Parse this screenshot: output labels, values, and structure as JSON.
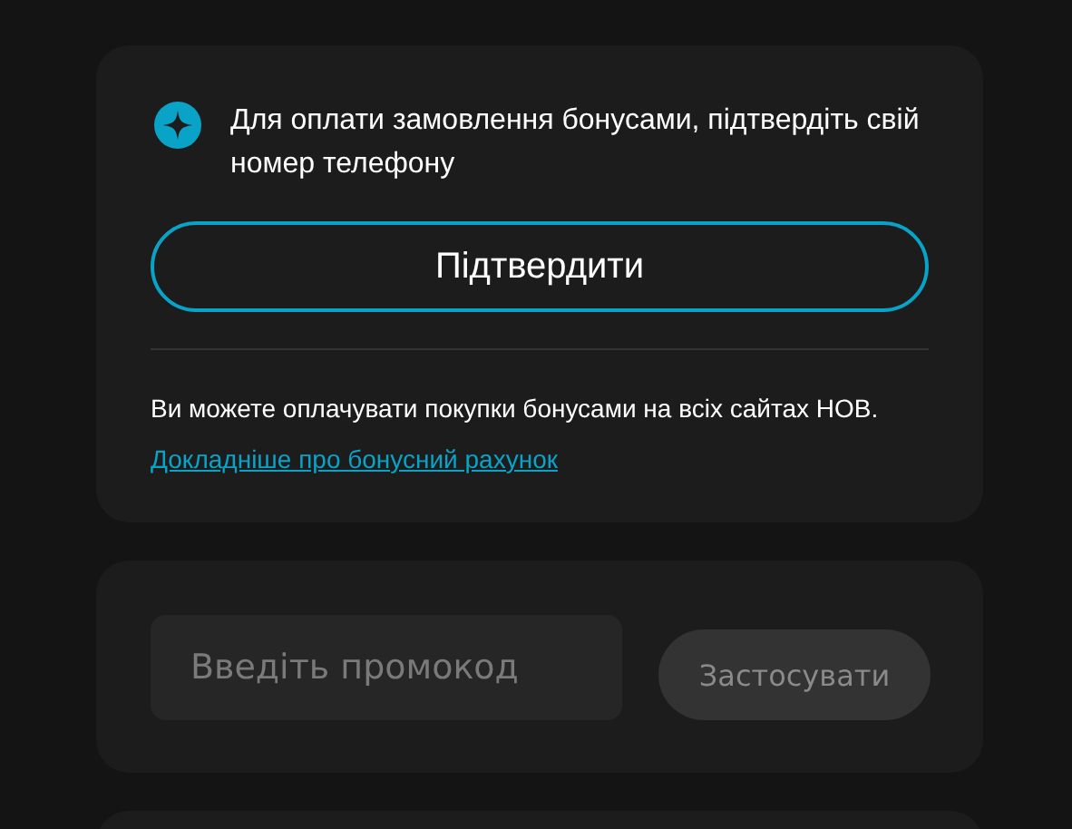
{
  "bonus_card": {
    "message": "Для оплати замовлення бонусами, підтвердіть свій номер телефону",
    "confirm_button": "Підтвердити",
    "info": "Ви можете оплачувати покупки бонусами на всіх сайтах НОВ.",
    "link": "Докладніше про бонусний рахунок"
  },
  "promo_card": {
    "placeholder": "Введіть промокод",
    "apply_button": {
      "label": "Застосувати",
      "disabled": true
    }
  }
}
